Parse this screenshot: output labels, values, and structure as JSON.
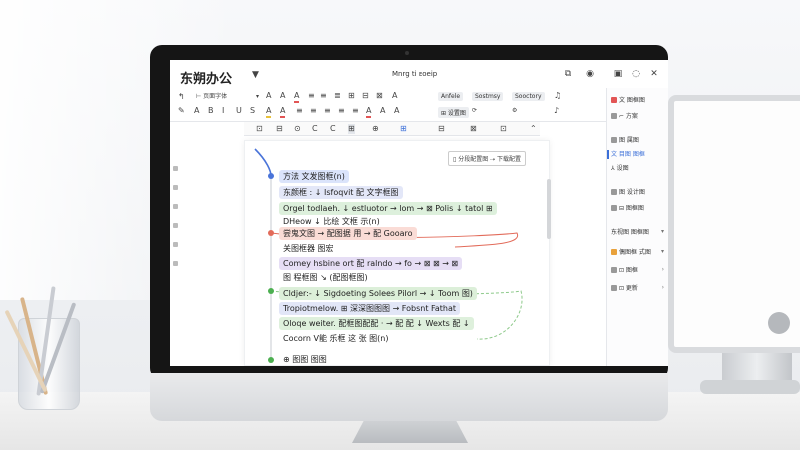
{
  "app": {
    "title": "东朔办公",
    "doc_title": "Mnrg ti ᴇoeip"
  },
  "titlebar_icons": [
    "share-icon",
    "copilot-icon",
    "panel-icon",
    "chat-icon",
    "close-icon"
  ],
  "toolbar": {
    "font_name": "⊢ 页面字体",
    "row1_tools": [
      "↑",
      "T",
      "B",
      "I",
      "U",
      "A",
      "≡",
      "≣",
      "⊞",
      "⊟",
      "⊠",
      "A",
      "♫"
    ],
    "chips": [
      "Anfele",
      "⊞ 设置图",
      "Sostmsy",
      "Sooctory"
    ],
    "row2_tools": [
      "A",
      "A",
      "A",
      "≡",
      "≡",
      "≡",
      "≡",
      "≡",
      "≡",
      "A",
      "A",
      "A",
      "≡",
      "≡"
    ]
  },
  "subbar_tools": [
    "⊡",
    "⊟",
    "⊙",
    "C",
    "C",
    "⊞",
    "⊕",
    "⊠",
    "⊡",
    "⊞",
    "⊡",
    "⊠",
    "⌃"
  ],
  "doc": {
    "button_label": "▯ 分段配置图 ⇢ 下载配置",
    "nodes": [
      {
        "text": "方法 文发图框(n)",
        "color": "#dbe4fb"
      },
      {
        "text": "东颜框 : ↓ Isfoqvit 配 文字框图",
        "color": "#e3e7f8"
      },
      {
        "text": "Orgel todlaeh. ↓ estluotor → lom → ⊠ Polis ↓ tatol ⊞",
        "color": "#ddf0dc"
      },
      {
        "text": "DHeow ↓ 比绘 文框 示(n)",
        "color": ""
      },
      {
        "text": "尝鬼文图 → 配图据 用   → 配 Gooaro",
        "color": "#fadcd6"
      },
      {
        "text": "关图框器 图宏 ",
        "color": ""
      },
      {
        "text": "Comey hsbine ort 配 ralndo → fo → ⊠ ⊠ → ⊠",
        "color": "#e6def5"
      },
      {
        "text": "图 程框图  ↘ (配图框图)",
        "color": ""
      },
      {
        "text": "Cldjer:- ↓  Sigdoeting Solees Pilorl → ↓ Toom 图)",
        "color": "#dcefd9"
      },
      {
        "text": "Tropiotmelow. ⊞ 深深图图图 → Fobsnt Fathat",
        "color": "#e2e6f7"
      },
      {
        "text": "Oloqe weiter. 配框图配配 · → 配 配 ↓ Wexts 配 ↓",
        "color": "#def0dc"
      },
      {
        "text": "Cocorn V能 乐框 这 张 图(n)",
        "color": ""
      },
      {
        "text": "⊕ 图图 图图",
        "color": ""
      }
    ]
  },
  "sidebar": {
    "items": [
      {
        "label": "文 图框图",
        "icon_color": "#e25555"
      },
      {
        "label": "⌐ 方案",
        "icon_color": "#777"
      },
      {
        "label": "图 属图 ",
        "icon_color": "#777"
      },
      {
        "label": "文 目图 图框",
        "icon_color": "#3b6fd8"
      },
      {
        "label": "⅄ 设图",
        "icon_color": "#777"
      },
      {
        "label": "图 设计图",
        "icon_color": "#777"
      },
      {
        "label": "⊟ 图框图",
        "icon_color": "#777"
      },
      {
        "label": "东视图 图框图",
        "icon_color": "#777"
      },
      {
        "label": "偶图框 式图",
        "icon_color": "#e8a13b"
      },
      {
        "label": "⊡ 图框",
        "icon_color": "#777"
      },
      {
        "label": "⊡ 更新",
        "icon_color": "#777"
      }
    ]
  },
  "colors": {
    "accent_blue": "#3b6fd8",
    "node_dot_blue": "#4a74d9",
    "node_dot_red": "#e26b5a",
    "node_dot_green": "#4caf50"
  }
}
